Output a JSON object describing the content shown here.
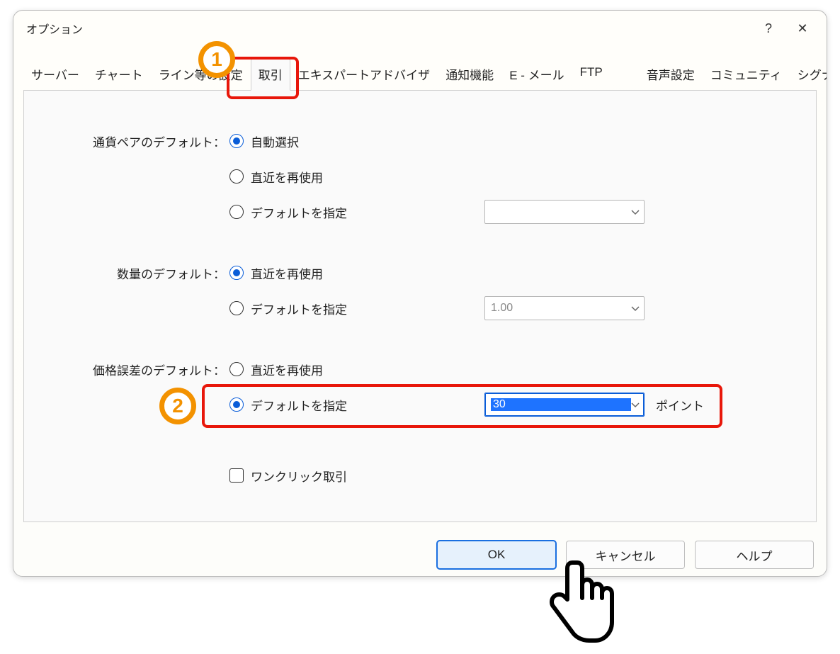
{
  "window": {
    "title": "オプション",
    "help_tooltip": "?",
    "close_tooltip": "✕"
  },
  "tabs": {
    "items": [
      "サーバー",
      "チャート",
      "ライン等の設定",
      "取引",
      "エキスパートアドバイザ",
      "通知機能",
      "E - メール",
      "FTP",
      "音声設定",
      "コミュニティ",
      "シグナル"
    ],
    "active_index": 3
  },
  "section": {
    "currency_pair": {
      "label": "通貨ペアのデフォルト：",
      "opt_auto": "自動選択",
      "opt_last": "直近を再使用",
      "opt_default": "デフォルトを指定",
      "selected": 0,
      "combo_value": ""
    },
    "volume": {
      "label": "数量のデフォルト：",
      "opt_last": "直近を再使用",
      "opt_default": "デフォルトを指定",
      "selected": 0,
      "combo_value": "1.00"
    },
    "deviation": {
      "label": "価格誤差のデフォルト：",
      "opt_last": "直近を再使用",
      "opt_default": "デフォルトを指定",
      "selected": 1,
      "combo_value": "30",
      "unit": "ポイント"
    },
    "one_click": {
      "label": "ワンクリック取引",
      "checked": false
    }
  },
  "footer": {
    "ok": "OK",
    "cancel": "キャンセル",
    "help": "ヘルプ"
  },
  "annotations": {
    "badge1": "1",
    "badge2": "2"
  }
}
